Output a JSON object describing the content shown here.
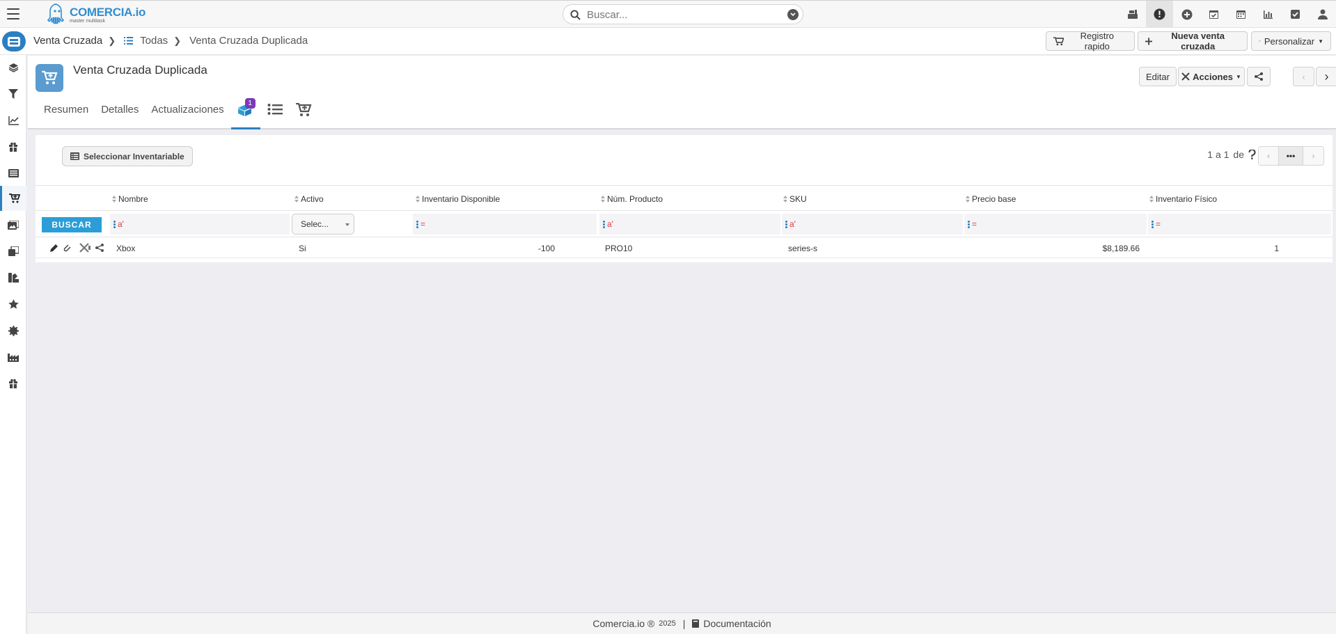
{
  "topbar": {
    "logo_text": "COMERCIA.io",
    "logo_subtitle": "master multitask",
    "search_placeholder": "Buscar...",
    "icons": [
      "cash-register-icon",
      "alert-icon",
      "plus-circle-icon",
      "calendar-check-icon",
      "calendar-icon",
      "bar-chart-icon",
      "checkbox-icon",
      "user-icon"
    ]
  },
  "breadcrumb": {
    "module": "Venta Cruzada",
    "list": "Todas",
    "current": "Venta Cruzada Duplicada"
  },
  "actions": {
    "quick_register": "Registro rapido",
    "new_sale": "Nueva venta cruzada",
    "customize": "Personalizar"
  },
  "record": {
    "title": "Venta Cruzada Duplicada",
    "edit": "Editar",
    "actions": "Acciones"
  },
  "tabs": {
    "summary": "Resumen",
    "details": "Detalles",
    "updates": "Actualizaciones",
    "inventory_badge": "1"
  },
  "panel": {
    "select_button": "Seleccionar Inventariable",
    "pagination": "1 a 1",
    "pagination_of": "de",
    "more": "•••"
  },
  "table": {
    "headers": [
      "Nombre",
      "Activo",
      "Inventario Disponible",
      "Núm. Producto",
      "SKU",
      "Precio base",
      "Inventario Físico"
    ],
    "search_button": "BUSCAR",
    "filter_select": "Selec...",
    "filter_text_op": "a'",
    "filter_eq_op": "=",
    "rows": [
      {
        "nombre": "Xbox",
        "activo": "Si",
        "inventario_disponible": "-100",
        "num_producto": "PRO10",
        "sku": "series-s",
        "precio_base": "$8,189.66",
        "inventario_fisico": "1"
      }
    ]
  },
  "footer": {
    "brand": "Comercia.io ®",
    "year": "2025",
    "separator": "|",
    "docs": "Documentación"
  },
  "colors": {
    "accent": "#2b7fc1",
    "search_button": "#2b9ed8",
    "badge": "#7b3ab8",
    "record_icon": "#5a9bd0"
  }
}
